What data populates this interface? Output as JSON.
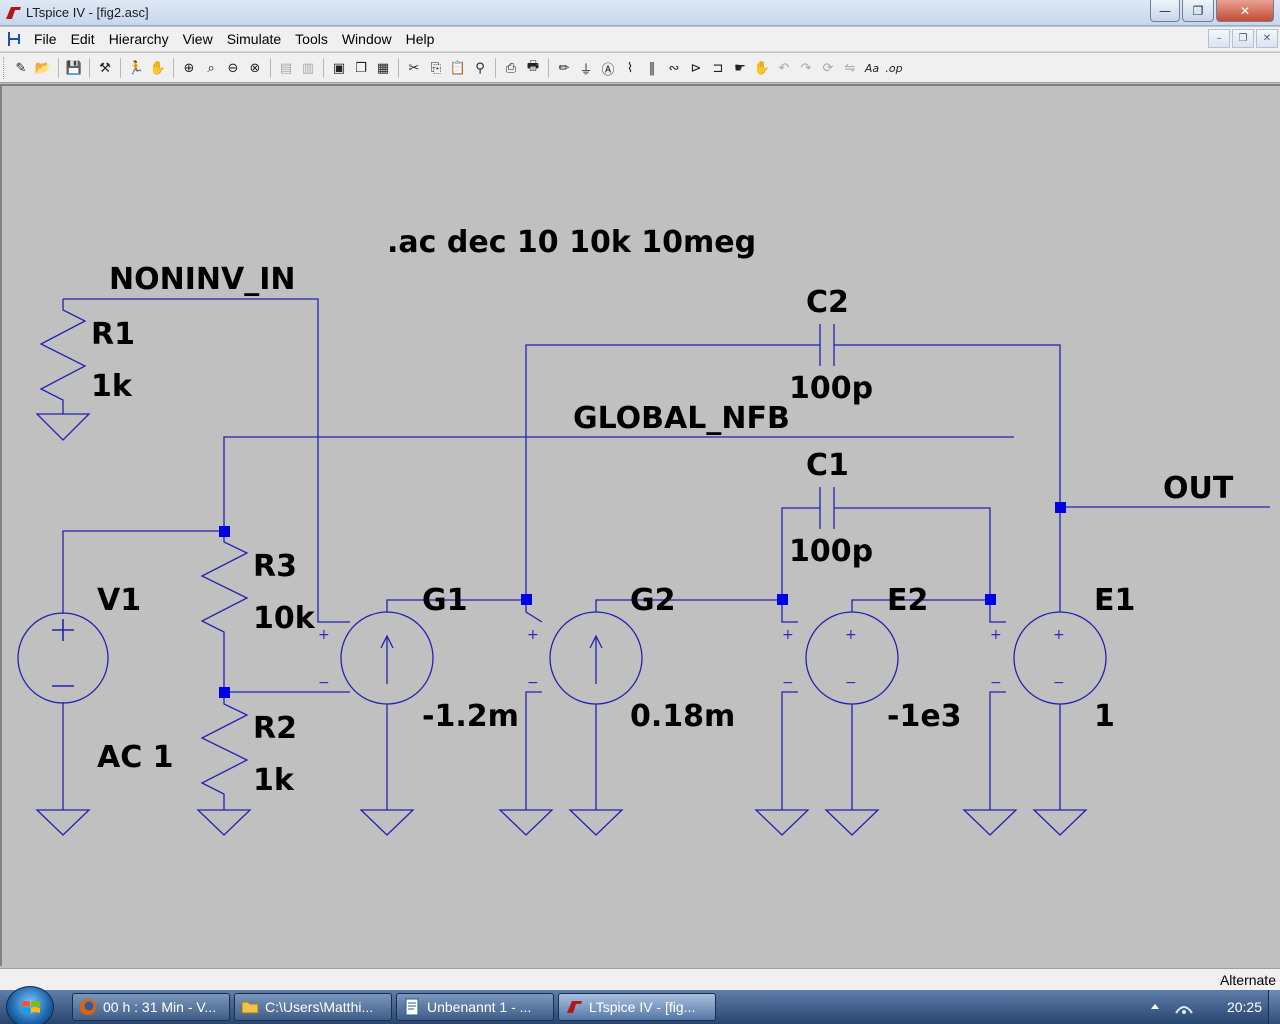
{
  "window": {
    "title": "LTspice IV - [fig2.asc]",
    "buttons": {
      "minimize": "—",
      "maximize": "❐",
      "close": "✕"
    }
  },
  "menu": {
    "items": [
      "File",
      "Edit",
      "Hierarchy",
      "View",
      "Simulate",
      "Tools",
      "Window",
      "Help"
    ],
    "mdi_buttons": [
      "–",
      "❐",
      "✕"
    ]
  },
  "toolbar": {
    "icons": [
      "new-schematic-icon",
      "open-icon",
      "save-icon",
      "control-panel-icon",
      "run-icon",
      "halt-icon",
      "zoom-in-icon",
      "zoom-pan-icon",
      "zoom-out-icon",
      "zoom-fit-icon",
      "tile-horizontal-icon",
      "tile-vertical-icon",
      "cascade-icon",
      "window-list-icon",
      "close-window-icon",
      "cut-icon",
      "copy-icon",
      "paste-icon",
      "find-icon",
      "print-setup-icon",
      "print-icon",
      "wire-icon",
      "ground-icon",
      "label-icon",
      "resistor-icon",
      "capacitor-icon",
      "inductor-icon",
      "diode-icon",
      "component-icon",
      "move-icon",
      "drag-icon",
      "undo-icon",
      "redo-icon",
      "rotate-icon",
      "mirror-icon",
      "text-icon",
      "spice-directive-icon"
    ]
  },
  "schematic": {
    "directive": ".ac dec 10 10k 10meg",
    "net_labels": {
      "noninv_in": "NONINV_IN",
      "global_nfb": "GLOBAL_NFB",
      "out": "OUT"
    },
    "components": {
      "R1": {
        "name": "R1",
        "value": "1k"
      },
      "R2": {
        "name": "R2",
        "value": "1k"
      },
      "R3": {
        "name": "R3",
        "value": "10k"
      },
      "V1": {
        "name": "V1",
        "value": "AC 1"
      },
      "G1": {
        "name": "G1",
        "value": "-1.2m"
      },
      "G2": {
        "name": "G2",
        "value": "0.18m"
      },
      "E2": {
        "name": "E2",
        "value": "-1e3"
      },
      "E1": {
        "name": "E1",
        "value": "1"
      },
      "C1": {
        "name": "C1",
        "value": "100p"
      },
      "C2": {
        "name": "C2",
        "value": "100p"
      }
    },
    "pin_plus": "+",
    "pin_minus": "−",
    "colors": {
      "wire": "#2222b0",
      "junction": "#0000e6",
      "background": "#c0c0c0"
    }
  },
  "statusbar": {
    "text": "Alternate"
  },
  "taskbar": {
    "tasks": [
      {
        "label": "00 h : 31 Min - V...",
        "icon": "firefox-icon"
      },
      {
        "label": "C:\\Users\\Matthi...",
        "icon": "folder-icon"
      },
      {
        "label": "Unbenannt 1 - ...",
        "icon": "writer-icon"
      },
      {
        "label": "LTspice IV - [fig...",
        "icon": "ltspice-icon"
      }
    ],
    "clock": "20:25"
  }
}
